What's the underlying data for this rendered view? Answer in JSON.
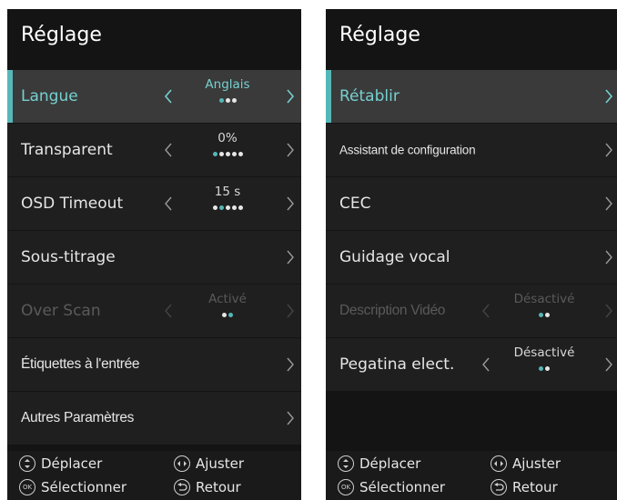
{
  "colors": {
    "accent": "#56b7b7",
    "background": "#141414",
    "row": "#1f1f1f",
    "row_selected": "#3a3a3a"
  },
  "left_panel": {
    "title": "Réglage",
    "rows": [
      {
        "label": "Langue",
        "value": "Anglais",
        "dots_total": 3,
        "dots_active": 1,
        "selected": true
      },
      {
        "label": "Transparent",
        "value": "0%",
        "dots_total": 5,
        "dots_active": 1
      },
      {
        "label": "OSD Timeout",
        "value": "15 s",
        "dots_total": 5,
        "dots_active": 2
      },
      {
        "label": "Sous-titrage"
      },
      {
        "label": "Over Scan",
        "value": "Activé",
        "dots_total": 2,
        "dots_active": 1,
        "disabled": true
      },
      {
        "label": "Étiquettes à l'entrée"
      },
      {
        "label": "Autres Paramètres"
      }
    ]
  },
  "right_panel": {
    "title": "Réglage",
    "rows": [
      {
        "label": "Rétablir",
        "selected": true
      },
      {
        "label": "Assistant de configuration"
      },
      {
        "label": "CEC"
      },
      {
        "label": "Guidage vocal"
      },
      {
        "label": "Description Vidéo",
        "value": "Désactivé",
        "dots_total": 2,
        "dots_active": 1,
        "disabled": true
      },
      {
        "label": "Pegatina elect.",
        "value": "Désactivé",
        "dots_total": 2,
        "dots_active": 1
      }
    ]
  },
  "footer": {
    "move": {
      "label": "Déplacer",
      "icon": "up-down-icon"
    },
    "adjust": {
      "label": "Ajuster",
      "icon": "left-right-icon"
    },
    "select": {
      "label": "Sélectionner",
      "icon": "ok-icon",
      "icon_text": "OK"
    },
    "back": {
      "label": "Retour",
      "icon": "back-icon"
    }
  }
}
